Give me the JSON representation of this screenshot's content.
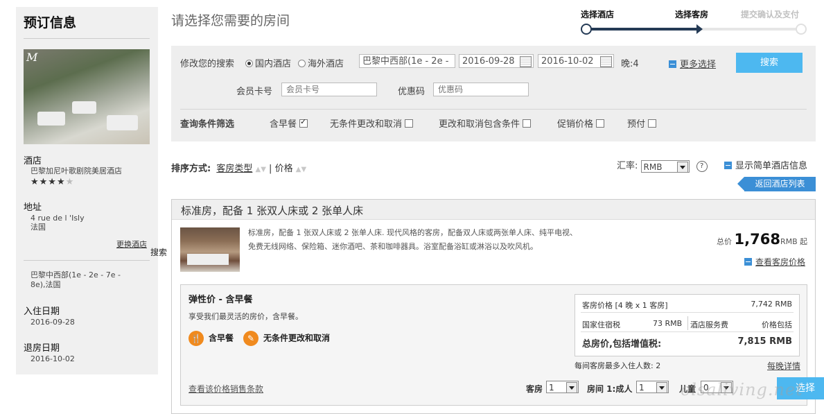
{
  "sidebar": {
    "title": "预订信息",
    "hotel_label": "酒店",
    "hotel_name": "巴黎加尼叶歌剧院美居酒店",
    "stars_filled": "★★★★",
    "stars_empty": "★",
    "star_rating": 4,
    "address_label": "地址",
    "address_line1": "4 rue de l 'Isly",
    "address_line2": "法国",
    "change_hotel": "更换酒店",
    "district_line1": "巴黎中西部(1e - 2e - 7e -",
    "district_line2": "8e),法国",
    "checkin_label": "入住日期",
    "checkin_date": "2016-09-28",
    "checkout_label": "退房日期",
    "checkout_date": "2016-10-02",
    "photo_logo": "M"
  },
  "stray_text": "搜索",
  "page_title": "请选择您需要的房间",
  "steps": [
    "选择酒店",
    "选择客房",
    "提交确认及支付"
  ],
  "search": {
    "modify_label": "修改您的搜索",
    "domestic": "国内酒店",
    "overseas": "海外酒店",
    "destination": "巴黎中西部(1e - 2e -",
    "checkin": "2016-09-28",
    "checkout": "2016-10-02",
    "nights": "晚:4",
    "more_options": "更多选择",
    "search_button": "搜索",
    "member_label": "会员卡号",
    "member_placeholder": "会员卡号",
    "promo_label": "优惠码",
    "promo_placeholder": "优惠码",
    "filter_label": "查询条件筛选",
    "filters": [
      {
        "label": "含早餐",
        "checked": true
      },
      {
        "label": "无条件更改和取消",
        "checked": false
      },
      {
        "label": "更改和取消包含条件",
        "checked": false
      },
      {
        "label": "促销价格",
        "checked": false
      },
      {
        "label": "预付",
        "checked": false
      }
    ]
  },
  "sort": {
    "label": "排序方式:",
    "room_type": "客房类型",
    "separator": "|",
    "price": "价格"
  },
  "currency": {
    "label": "汇率:",
    "value": "RMB",
    "help": "?"
  },
  "simple_info": "显示简单酒店信息",
  "back_to_list": "返回酒店列表",
  "room": {
    "title": "标准房，配备 1 张双人床或 2 张单人床",
    "desc_line1": "标准房，配备 1 张双人床或 2 张单人床. 现代风格的客房，配备双人床或两张单人床、纯平电视、",
    "desc_line2": "免费无线网络、保险箱、迷你酒吧、茶和咖啡器具。浴室配备浴缸或淋浴以及吹风机。",
    "total_prefix": "总价",
    "total_amount": "1,768",
    "total_suffix": "RMB 起",
    "view_prices": "查看客房价格",
    "rate": {
      "title": "弹性价 - 含早餐",
      "subtitle": "享受我们最灵活的房价，含早餐。",
      "feature1": "含早餐",
      "feature2": "无条件更改和取消",
      "price_label": "客房价格 [4 晚 x 1 客房]",
      "price_value": "7,742 RMB",
      "tax_label": "国家住宿税",
      "tax_value": "73 RMB",
      "service_label": "酒店服务费",
      "service_value": "价格包括",
      "total_label": "总房价,包括增值税:",
      "total_value": "7,815 RMB",
      "max_guests": "每间客房最多入住人数: 2",
      "nightly": "每晚详情",
      "terms": "查看该价格销售条款",
      "rooms_label": "客房",
      "rooms_value": "1",
      "adults_label": "房间 1:成人",
      "adults_value": "1",
      "children_label": "儿童",
      "children_value": "0",
      "select_button": "选择"
    }
  },
  "watermark": "elsaliving.net",
  "colors": {
    "accent_blue": "#4db8f0",
    "dark_blue": "#243a55",
    "link_blue": "#3b8fd6",
    "orange": "#f08a1e"
  }
}
